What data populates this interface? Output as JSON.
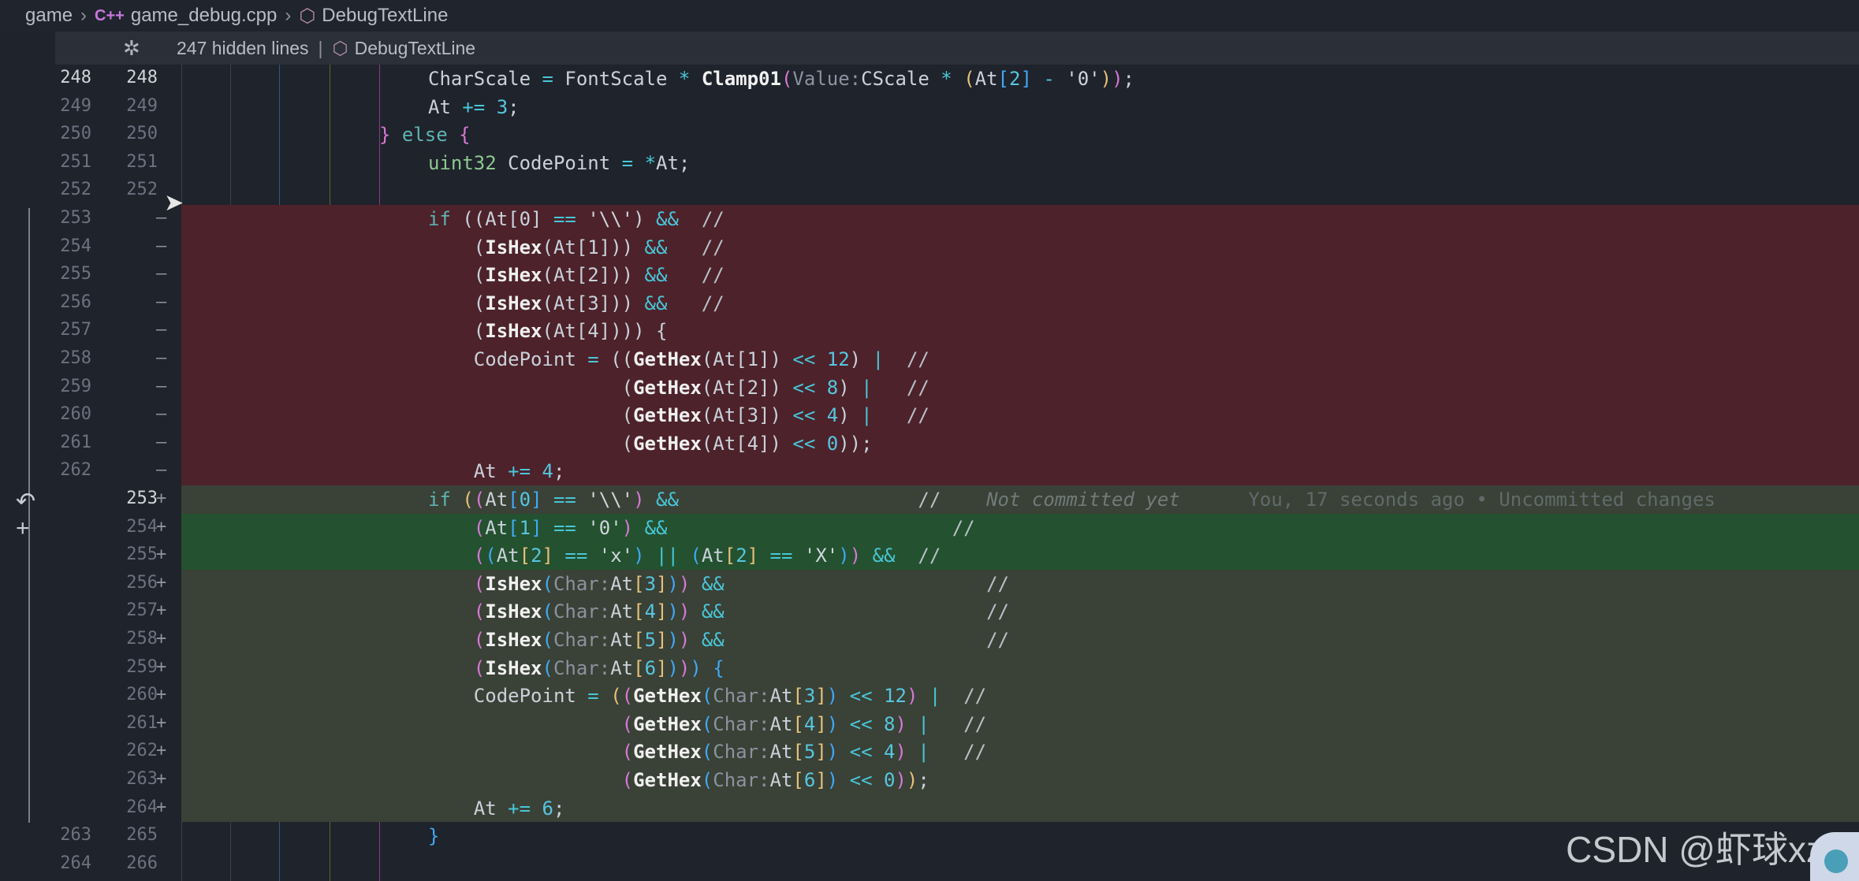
{
  "breadcrumb": {
    "root": "game",
    "file": "game_debug.cpp",
    "symbol": "DebugTextLine",
    "cpp_badge": "C++"
  },
  "folded": {
    "count": "247 hidden lines",
    "separator": "|",
    "symbol": "DebugTextLine"
  },
  "watermark": "CSDN @虾球xz",
  "lines": [
    {
      "old": "248",
      "new": "248",
      "mark": "",
      "type": "ctx",
      "cur": true
    },
    {
      "old": "249",
      "new": "249",
      "mark": "",
      "type": "ctx"
    },
    {
      "old": "250",
      "new": "250",
      "mark": "",
      "type": "ctx"
    },
    {
      "old": "251",
      "new": "251",
      "mark": "",
      "type": "ctx"
    },
    {
      "old": "252",
      "new": "252",
      "mark": "",
      "type": "ctx"
    },
    {
      "old": "253",
      "new": "",
      "mark": "—",
      "type": "del"
    },
    {
      "old": "254",
      "new": "",
      "mark": "—",
      "type": "del"
    },
    {
      "old": "255",
      "new": "",
      "mark": "—",
      "type": "del"
    },
    {
      "old": "256",
      "new": "",
      "mark": "—",
      "type": "del"
    },
    {
      "old": "257",
      "new": "",
      "mark": "—",
      "type": "del"
    },
    {
      "old": "258",
      "new": "",
      "mark": "—",
      "type": "del"
    },
    {
      "old": "259",
      "new": "",
      "mark": "—",
      "type": "del"
    },
    {
      "old": "260",
      "new": "",
      "mark": "—",
      "type": "del"
    },
    {
      "old": "261",
      "new": "",
      "mark": "—",
      "type": "del"
    },
    {
      "old": "262",
      "new": "",
      "mark": "—",
      "type": "del"
    },
    {
      "old": "",
      "new": "253",
      "mark": "+",
      "type": "add",
      "cur": true
    },
    {
      "old": "",
      "new": "254",
      "mark": "+",
      "type": "add-strong"
    },
    {
      "old": "",
      "new": "255",
      "mark": "+",
      "type": "add-strong"
    },
    {
      "old": "",
      "new": "256",
      "mark": "+",
      "type": "add"
    },
    {
      "old": "",
      "new": "257",
      "mark": "+",
      "type": "add"
    },
    {
      "old": "",
      "new": "258",
      "mark": "+",
      "type": "add"
    },
    {
      "old": "",
      "new": "259",
      "mark": "+",
      "type": "add"
    },
    {
      "old": "",
      "new": "260",
      "mark": "+",
      "type": "add"
    },
    {
      "old": "",
      "new": "261",
      "mark": "+",
      "type": "add"
    },
    {
      "old": "",
      "new": "262",
      "mark": "+",
      "type": "add"
    },
    {
      "old": "",
      "new": "263",
      "mark": "+",
      "type": "add"
    },
    {
      "old": "",
      "new": "264",
      "mark": "+",
      "type": "add"
    },
    {
      "old": "263",
      "new": "265",
      "mark": "",
      "type": "ctx"
    },
    {
      "old": "264",
      "new": "266",
      "mark": "",
      "type": "ctx"
    }
  ],
  "code": [
    [
      {
        "t": "CharScale ",
        "c": ""
      },
      {
        "t": "= ",
        "c": "op"
      },
      {
        "t": "FontScale ",
        "c": ""
      },
      {
        "t": "* ",
        "c": "op"
      },
      {
        "t": "Clamp01",
        "c": "fn"
      },
      {
        "t": "(",
        "c": "br2"
      },
      {
        "t": "Value:",
        "c": "hint"
      },
      {
        "t": "CScale ",
        "c": ""
      },
      {
        "t": "* ",
        "c": "op"
      },
      {
        "t": "(",
        "c": "br1"
      },
      {
        "t": "At",
        "c": ""
      },
      {
        "t": "[",
        "c": "br3"
      },
      {
        "t": "2",
        "c": "num"
      },
      {
        "t": "]",
        "c": "br3"
      },
      {
        "t": " - ",
        "c": "op"
      },
      {
        "t": "'0'",
        "c": "str"
      },
      {
        "t": ")",
        "c": "br1"
      },
      {
        "t": ")",
        "c": "br2"
      },
      {
        "t": ";",
        "c": ""
      }
    ],
    [
      {
        "t": "At ",
        "c": ""
      },
      {
        "t": "+= ",
        "c": "op"
      },
      {
        "t": "3",
        "c": "num"
      },
      {
        "t": ";",
        "c": ""
      }
    ],
    [
      {
        "t": "} ",
        "c": "br2"
      },
      {
        "t": "else ",
        "c": "kw"
      },
      {
        "t": "{",
        "c": "br2"
      }
    ],
    [
      {
        "t": "uint32 ",
        "c": "ty"
      },
      {
        "t": "CodePoint ",
        "c": ""
      },
      {
        "t": "= ",
        "c": "op"
      },
      {
        "t": "*",
        "c": "op"
      },
      {
        "t": "At;",
        "c": ""
      }
    ],
    [],
    [
      {
        "t": "if ",
        "c": "kw"
      },
      {
        "t": "((At[0] ",
        "c": ""
      },
      {
        "t": "== ",
        "c": "op"
      },
      {
        "t": "'\\\\'",
        "c": "str"
      },
      {
        "t": ") ",
        "c": ""
      },
      {
        "t": "&&  ",
        "c": "op"
      },
      {
        "t": "//",
        "c": "cm"
      }
    ],
    [
      {
        "t": "    (",
        "c": ""
      },
      {
        "t": "IsHex",
        "c": "fn"
      },
      {
        "t": "(At[1])) ",
        "c": ""
      },
      {
        "t": "&&   ",
        "c": "op"
      },
      {
        "t": "//",
        "c": "cm"
      }
    ],
    [
      {
        "t": "    (",
        "c": ""
      },
      {
        "t": "IsHex",
        "c": "fn"
      },
      {
        "t": "(At[2])) ",
        "c": ""
      },
      {
        "t": "&&   ",
        "c": "op"
      },
      {
        "t": "//",
        "c": "cm"
      }
    ],
    [
      {
        "t": "    (",
        "c": ""
      },
      {
        "t": "IsHex",
        "c": "fn"
      },
      {
        "t": "(At[3])) ",
        "c": ""
      },
      {
        "t": "&&   ",
        "c": "op"
      },
      {
        "t": "//",
        "c": "cm"
      }
    ],
    [
      {
        "t": "    (",
        "c": ""
      },
      {
        "t": "IsHex",
        "c": "fn"
      },
      {
        "t": "(At[4]))) {",
        "c": ""
      }
    ],
    [
      {
        "t": "    CodePoint ",
        "c": ""
      },
      {
        "t": "= ",
        "c": "op"
      },
      {
        "t": "((",
        "c": ""
      },
      {
        "t": "GetHex",
        "c": "fn"
      },
      {
        "t": "(At[1]) ",
        "c": ""
      },
      {
        "t": "<< ",
        "c": "op"
      },
      {
        "t": "12",
        "c": "num"
      },
      {
        "t": ") ",
        "c": ""
      },
      {
        "t": "|  ",
        "c": "op"
      },
      {
        "t": "//",
        "c": "cm"
      }
    ],
    [
      {
        "t": "                 (",
        "c": ""
      },
      {
        "t": "GetHex",
        "c": "fn"
      },
      {
        "t": "(At[2]) ",
        "c": ""
      },
      {
        "t": "<< ",
        "c": "op"
      },
      {
        "t": "8",
        "c": "num"
      },
      {
        "t": ") ",
        "c": ""
      },
      {
        "t": "|   ",
        "c": "op"
      },
      {
        "t": "//",
        "c": "cm"
      }
    ],
    [
      {
        "t": "                 (",
        "c": ""
      },
      {
        "t": "GetHex",
        "c": "fn"
      },
      {
        "t": "(At[3]) ",
        "c": ""
      },
      {
        "t": "<< ",
        "c": "op"
      },
      {
        "t": "4",
        "c": "num"
      },
      {
        "t": ") ",
        "c": ""
      },
      {
        "t": "|   ",
        "c": "op"
      },
      {
        "t": "//",
        "c": "cm"
      }
    ],
    [
      {
        "t": "                 (",
        "c": ""
      },
      {
        "t": "GetHex",
        "c": "fn"
      },
      {
        "t": "(At[4]) ",
        "c": ""
      },
      {
        "t": "<< ",
        "c": "op"
      },
      {
        "t": "0",
        "c": "num"
      },
      {
        "t": "));",
        "c": ""
      }
    ],
    [
      {
        "t": "    At ",
        "c": ""
      },
      {
        "t": "+= ",
        "c": "op"
      },
      {
        "t": "4",
        "c": "num"
      },
      {
        "t": ";",
        "c": ""
      }
    ],
    [
      {
        "t": "if ",
        "c": "kw"
      },
      {
        "t": "(",
        "c": "br1"
      },
      {
        "t": "(",
        "c": "br2"
      },
      {
        "t": "At",
        "c": ""
      },
      {
        "t": "[",
        "c": "br3"
      },
      {
        "t": "0",
        "c": "num"
      },
      {
        "t": "]",
        "c": "br3"
      },
      {
        "t": " == ",
        "c": "op"
      },
      {
        "t": "'\\\\'",
        "c": "str"
      },
      {
        "t": ") ",
        "c": "br2"
      },
      {
        "t": "&&                     ",
        "c": "op"
      },
      {
        "t": "//    ",
        "c": "cm"
      },
      {
        "t": "Not committed yet      ",
        "c": "blame"
      },
      {
        "t": "You, 17 seconds ago • Uncommitted changes",
        "c": "blame2"
      }
    ],
    [
      {
        "t": "    (",
        "c": "br2"
      },
      {
        "t": "At",
        "c": ""
      },
      {
        "t": "[",
        "c": "br3"
      },
      {
        "t": "1",
        "c": "num"
      },
      {
        "t": "]",
        "c": "br3"
      },
      {
        "t": " == ",
        "c": "op"
      },
      {
        "t": "'0'",
        "c": "str"
      },
      {
        "t": ") ",
        "c": "br2"
      },
      {
        "t": "&&                         ",
        "c": "op"
      },
      {
        "t": "//",
        "c": "cm"
      }
    ],
    [
      {
        "t": "    (",
        "c": "br2"
      },
      {
        "t": "(",
        "c": "br3"
      },
      {
        "t": "At",
        "c": ""
      },
      {
        "t": "[",
        "c": "br1"
      },
      {
        "t": "2",
        "c": "num"
      },
      {
        "t": "]",
        "c": "br1"
      },
      {
        "t": " == ",
        "c": "op"
      },
      {
        "t": "'x'",
        "c": "str"
      },
      {
        "t": ") ",
        "c": "br3"
      },
      {
        "t": "|| ",
        "c": "op"
      },
      {
        "t": "(",
        "c": "br3"
      },
      {
        "t": "At",
        "c": ""
      },
      {
        "t": "[",
        "c": "br1"
      },
      {
        "t": "2",
        "c": "num"
      },
      {
        "t": "]",
        "c": "br1"
      },
      {
        "t": " == ",
        "c": "op"
      },
      {
        "t": "'X'",
        "c": "str"
      },
      {
        "t": ")",
        "c": "br3"
      },
      {
        "t": ") ",
        "c": "br2"
      },
      {
        "t": "&&  ",
        "c": "op"
      },
      {
        "t": "//",
        "c": "cm"
      }
    ],
    [
      {
        "t": "    (",
        "c": "br2"
      },
      {
        "t": "IsHex",
        "c": "fn"
      },
      {
        "t": "(",
        "c": "br3"
      },
      {
        "t": "Char:",
        "c": "hint"
      },
      {
        "t": "At",
        "c": ""
      },
      {
        "t": "[",
        "c": "br1"
      },
      {
        "t": "3",
        "c": "num"
      },
      {
        "t": "]",
        "c": "br1"
      },
      {
        "t": ")",
        "c": "br3"
      },
      {
        "t": ") ",
        "c": "br2"
      },
      {
        "t": "&&                       ",
        "c": "op"
      },
      {
        "t": "//",
        "c": "cm"
      }
    ],
    [
      {
        "t": "    (",
        "c": "br2"
      },
      {
        "t": "IsHex",
        "c": "fn"
      },
      {
        "t": "(",
        "c": "br3"
      },
      {
        "t": "Char:",
        "c": "hint"
      },
      {
        "t": "At",
        "c": ""
      },
      {
        "t": "[",
        "c": "br1"
      },
      {
        "t": "4",
        "c": "num"
      },
      {
        "t": "]",
        "c": "br1"
      },
      {
        "t": ")",
        "c": "br3"
      },
      {
        "t": ") ",
        "c": "br2"
      },
      {
        "t": "&&                       ",
        "c": "op"
      },
      {
        "t": "//",
        "c": "cm"
      }
    ],
    [
      {
        "t": "    (",
        "c": "br2"
      },
      {
        "t": "IsHex",
        "c": "fn"
      },
      {
        "t": "(",
        "c": "br3"
      },
      {
        "t": "Char:",
        "c": "hint"
      },
      {
        "t": "At",
        "c": ""
      },
      {
        "t": "[",
        "c": "br1"
      },
      {
        "t": "5",
        "c": "num"
      },
      {
        "t": "]",
        "c": "br1"
      },
      {
        "t": ")",
        "c": "br3"
      },
      {
        "t": ") ",
        "c": "br2"
      },
      {
        "t": "&&                       ",
        "c": "op"
      },
      {
        "t": "//",
        "c": "cm"
      }
    ],
    [
      {
        "t": "    (",
        "c": "br2"
      },
      {
        "t": "IsHex",
        "c": "fn"
      },
      {
        "t": "(",
        "c": "br3"
      },
      {
        "t": "Char:",
        "c": "hint"
      },
      {
        "t": "At",
        "c": ""
      },
      {
        "t": "[",
        "c": "br1"
      },
      {
        "t": "6",
        "c": "num"
      },
      {
        "t": "]",
        "c": "br1"
      },
      {
        "t": ")",
        "c": "br3"
      },
      {
        "t": ")",
        "c": "br2"
      },
      {
        "t": ") {",
        "c": "br3"
      }
    ],
    [
      {
        "t": "    CodePoint ",
        "c": ""
      },
      {
        "t": "= ",
        "c": "op"
      },
      {
        "t": "(",
        "c": "br1"
      },
      {
        "t": "(",
        "c": "br2"
      },
      {
        "t": "GetHex",
        "c": "fn"
      },
      {
        "t": "(",
        "c": "br3"
      },
      {
        "t": "Char:",
        "c": "hint"
      },
      {
        "t": "At",
        "c": ""
      },
      {
        "t": "[",
        "c": "br1"
      },
      {
        "t": "3",
        "c": "num"
      },
      {
        "t": "]",
        "c": "br1"
      },
      {
        "t": ")",
        "c": "br3"
      },
      {
        "t": " << ",
        "c": "op"
      },
      {
        "t": "12",
        "c": "num"
      },
      {
        "t": ") ",
        "c": "br2"
      },
      {
        "t": "|  ",
        "c": "op"
      },
      {
        "t": "//",
        "c": "cm"
      }
    ],
    [
      {
        "t": "                 (",
        "c": "br2"
      },
      {
        "t": "GetHex",
        "c": "fn"
      },
      {
        "t": "(",
        "c": "br3"
      },
      {
        "t": "Char:",
        "c": "hint"
      },
      {
        "t": "At",
        "c": ""
      },
      {
        "t": "[",
        "c": "br1"
      },
      {
        "t": "4",
        "c": "num"
      },
      {
        "t": "]",
        "c": "br1"
      },
      {
        "t": ")",
        "c": "br3"
      },
      {
        "t": " << ",
        "c": "op"
      },
      {
        "t": "8",
        "c": "num"
      },
      {
        "t": ") ",
        "c": "br2"
      },
      {
        "t": "|   ",
        "c": "op"
      },
      {
        "t": "//",
        "c": "cm"
      }
    ],
    [
      {
        "t": "                 (",
        "c": "br2"
      },
      {
        "t": "GetHex",
        "c": "fn"
      },
      {
        "t": "(",
        "c": "br3"
      },
      {
        "t": "Char:",
        "c": "hint"
      },
      {
        "t": "At",
        "c": ""
      },
      {
        "t": "[",
        "c": "br1"
      },
      {
        "t": "5",
        "c": "num"
      },
      {
        "t": "]",
        "c": "br1"
      },
      {
        "t": ")",
        "c": "br3"
      },
      {
        "t": " << ",
        "c": "op"
      },
      {
        "t": "4",
        "c": "num"
      },
      {
        "t": ") ",
        "c": "br2"
      },
      {
        "t": "|   ",
        "c": "op"
      },
      {
        "t": "//",
        "c": "cm"
      }
    ],
    [
      {
        "t": "                 (",
        "c": "br2"
      },
      {
        "t": "GetHex",
        "c": "fn"
      },
      {
        "t": "(",
        "c": "br3"
      },
      {
        "t": "Char:",
        "c": "hint"
      },
      {
        "t": "At",
        "c": ""
      },
      {
        "t": "[",
        "c": "br1"
      },
      {
        "t": "6",
        "c": "num"
      },
      {
        "t": "]",
        "c": "br1"
      },
      {
        "t": ")",
        "c": "br3"
      },
      {
        "t": " << ",
        "c": "op"
      },
      {
        "t": "0",
        "c": "num"
      },
      {
        "t": ")",
        "c": "br2"
      },
      {
        "t": ")",
        "c": "br1"
      },
      {
        "t": ";",
        "c": ""
      }
    ],
    [
      {
        "t": "    At ",
        "c": ""
      },
      {
        "t": "+= ",
        "c": "op"
      },
      {
        "t": "6",
        "c": "num"
      },
      {
        "t": ";",
        "c": ""
      }
    ],
    [
      {
        "t": "}",
        "c": "br3"
      }
    ],
    []
  ],
  "indent": [
    4,
    4,
    3,
    4,
    4,
    4,
    4,
    4,
    4,
    4,
    4,
    4,
    4,
    4,
    4,
    4,
    4,
    4,
    4,
    4,
    4,
    4,
    4,
    4,
    4,
    4,
    4,
    4,
    4
  ]
}
